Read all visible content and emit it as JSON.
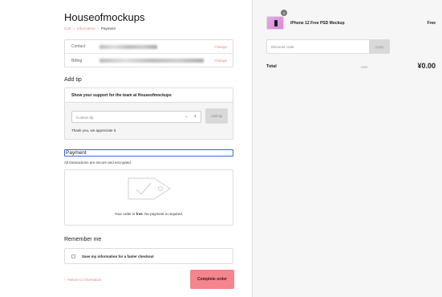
{
  "store": {
    "title": "Houseofmockups"
  },
  "breadcrumb": {
    "items": [
      {
        "label": "Cart"
      },
      {
        "label": "Information"
      },
      {
        "label": "Payment"
      }
    ],
    "separator": "›"
  },
  "info": {
    "contact_label": "Contact",
    "billing_label": "Billing",
    "change_label": "Change"
  },
  "tip": {
    "heading": "Add tip",
    "subheading": "Show your support for the team at Houseofmockups",
    "input_placeholder": "Custom tip",
    "minus": "−",
    "plus": "+",
    "add_label": "Add tip",
    "thanks": "Thank you, we appreciate it."
  },
  "payment": {
    "heading": "Payment",
    "secure_text": "All transactions are secure and encrypted.",
    "free_prefix": "Your order is ",
    "free_word": "free",
    "free_suffix": ". No payment is required."
  },
  "remember": {
    "heading": "Remember me",
    "checkbox_label": "Save my information for a faster checkout"
  },
  "footer": {
    "return_icon": "‹",
    "return_label": "Return to information",
    "complete_label": "Complete order"
  },
  "summary": {
    "product_name": "iPhone 12 Free PSD Mockup",
    "product_price": "Free",
    "quantity": "1",
    "discount_placeholder": "Discount code",
    "apply_label": "Apply",
    "total_label": "Total",
    "currency": "CNY",
    "total_amount": "¥0.00"
  },
  "colors": {
    "accent": "#e38b86",
    "complete_button": "#f4858e",
    "focus_outline": "#2f6de0"
  }
}
